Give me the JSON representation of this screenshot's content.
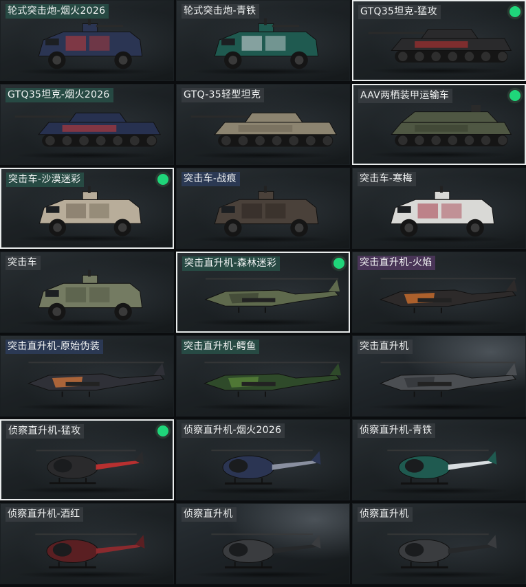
{
  "colors": {
    "background": "#0b0d0f",
    "selected_border": "#e9ecec",
    "owned_dot": "#1fd67a"
  },
  "items": [
    {
      "name": "轮式突击炮-烟火2026",
      "kind": "armored-car-cannon",
      "skin": "#2b3553",
      "accent": "#c23a3a",
      "tag": "tag-teal",
      "selected": false,
      "owned": false
    },
    {
      "name": "轮式突击炮-青铁",
      "kind": "armored-car-cannon",
      "skin": "#1f5a50",
      "accent": "#d8dde0",
      "tag": "tag-gray",
      "selected": false,
      "owned": false
    },
    {
      "name": "GTQ35坦克-猛攻",
      "kind": "tank",
      "skin": "#2a2a2c",
      "accent": "#b83030",
      "tag": "tag-gray",
      "selected": true,
      "owned": true
    },
    {
      "name": "GTQ35坦克-烟火2026",
      "kind": "tank",
      "skin": "#273150",
      "accent": "#c23a3a",
      "tag": "tag-teal",
      "selected": false,
      "owned": false
    },
    {
      "name": "GTQ-35轻型坦克",
      "kind": "tank",
      "skin": "#8c8470",
      "accent": "#6f6756",
      "tag": "tag-gray",
      "selected": false,
      "owned": false
    },
    {
      "name": "AAV两栖装甲运输车",
      "kind": "amphibious",
      "skin": "#4f5743",
      "accent": "#3a4030",
      "tag": "tag-gray",
      "selected": true,
      "owned": true
    },
    {
      "name": "突击车-沙漠迷彩",
      "kind": "armored-car",
      "skin": "#b8ad9a",
      "accent": "#6d6353",
      "tag": "tag-teal",
      "selected": true,
      "owned": true
    },
    {
      "name": "突击车-战痕",
      "kind": "armored-car",
      "skin": "#4a413a",
      "accent": "#2b2420",
      "tag": "tag-blue",
      "selected": false,
      "owned": false
    },
    {
      "name": "突击车-寒梅",
      "kind": "armored-car",
      "skin": "#d9d9d6",
      "accent": "#a53a4a",
      "tag": "tag-gray",
      "selected": false,
      "owned": false
    },
    {
      "name": "突击车",
      "kind": "armored-car",
      "skin": "#747b62",
      "accent": "#4d5340",
      "tag": "tag-gray",
      "selected": false,
      "owned": false
    },
    {
      "name": "突击直升机-森林迷彩",
      "kind": "attack-helicopter",
      "skin": "#5f6a4d",
      "accent": "#3a4230",
      "tag": "tag-teal",
      "selected": true,
      "owned": true
    },
    {
      "name": "突击直升机-火焰",
      "kind": "attack-helicopter",
      "skin": "#2d2a2a",
      "accent": "#e2782e",
      "tag": "tag-purple",
      "selected": false,
      "owned": false
    },
    {
      "name": "突击直升机-原始伪装",
      "kind": "attack-helicopter",
      "skin": "#2f3037",
      "accent": "#e07a3a",
      "tag": "tag-blue",
      "selected": false,
      "owned": false
    },
    {
      "name": "突击直升机-鳄鱼",
      "kind": "attack-helicopter",
      "skin": "#2f4a2a",
      "accent": "#5d8a3a",
      "tag": "tag-teal",
      "selected": false,
      "owned": false
    },
    {
      "name": "突击直升机",
      "kind": "attack-helicopter",
      "skin": "#4b4e52",
      "accent": "#2f3236",
      "tag": "tag-gray",
      "selected": false,
      "owned": false,
      "bgAlt": true
    },
    {
      "name": "侦察直升机-猛攻",
      "kind": "scout-helicopter",
      "skin": "#2a2a2c",
      "accent": "#b83030",
      "tag": "tag-gray",
      "selected": true,
      "owned": true
    },
    {
      "name": "侦察直升机-烟火2026",
      "kind": "scout-helicopter",
      "skin": "#2b3553",
      "accent": "#8a90a0",
      "tag": "tag-gray",
      "selected": false,
      "owned": false
    },
    {
      "name": "侦察直升机-青铁",
      "kind": "scout-helicopter",
      "skin": "#1f5a50",
      "accent": "#d8dde0",
      "tag": "tag-gray",
      "selected": false,
      "owned": false
    },
    {
      "name": "侦察直升机-酒红",
      "kind": "scout-helicopter",
      "skin": "#5a1f22",
      "accent": "#8a2a2e",
      "tag": "tag-gray",
      "selected": false,
      "owned": false
    },
    {
      "name": "侦察直升机",
      "kind": "scout-helicopter",
      "skin": "#3a3c3f",
      "accent": "#26282a",
      "tag": "tag-gray",
      "selected": false,
      "owned": false,
      "bgAlt": true
    },
    {
      "name": "侦察直升机",
      "kind": "scout-helicopter",
      "skin": "#3a3c3f",
      "accent": "#26282a",
      "tag": "tag-gray",
      "selected": false,
      "owned": false
    }
  ]
}
